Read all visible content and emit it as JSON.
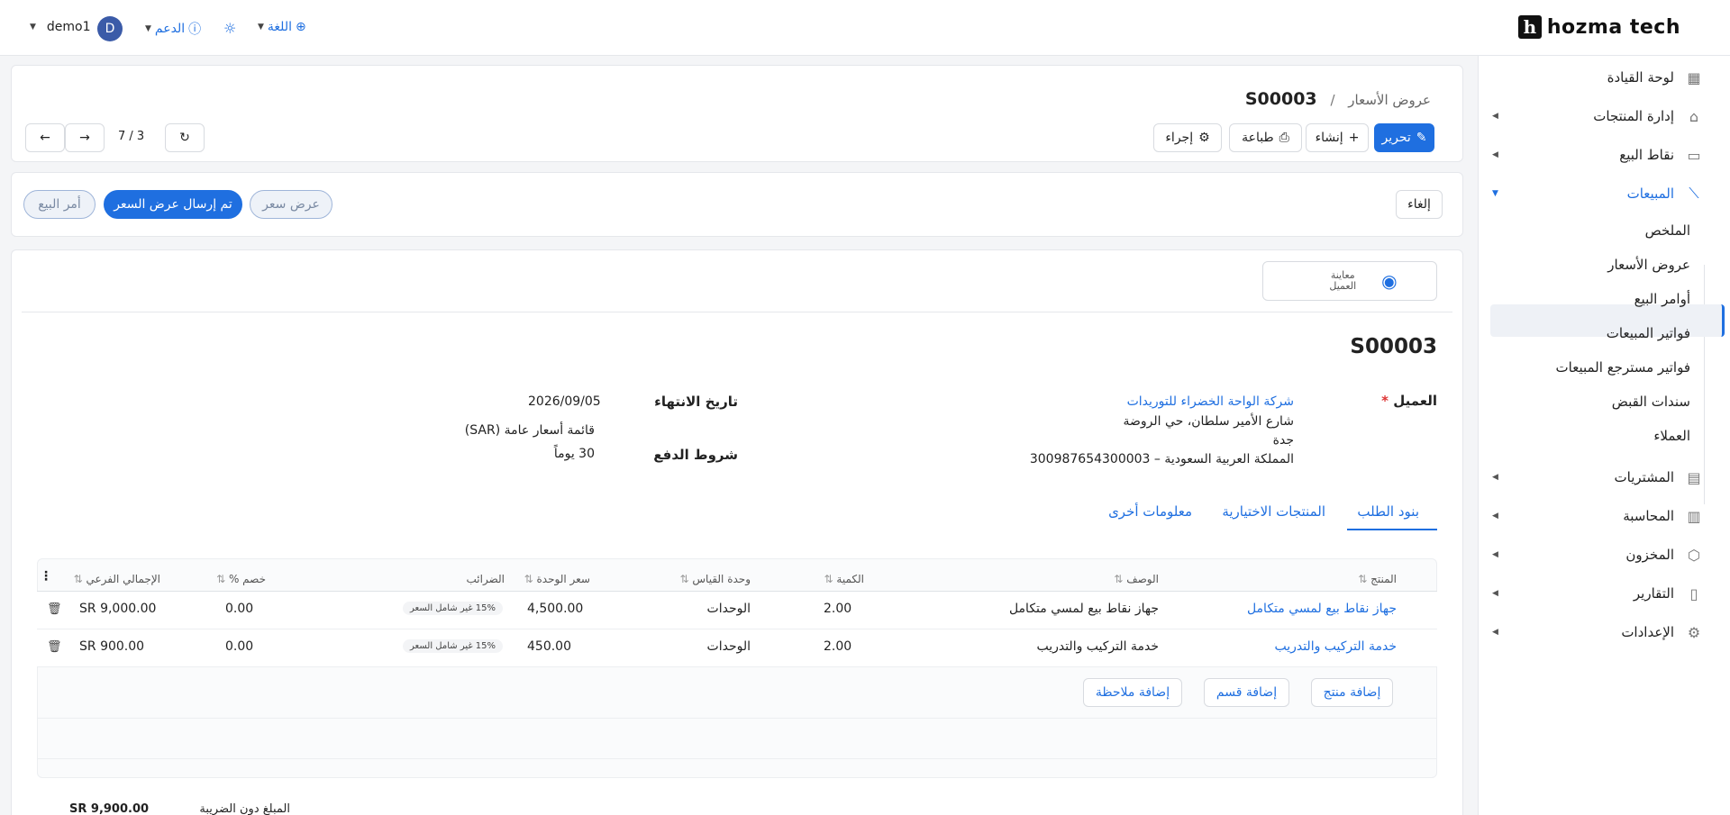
{
  "brand": {
    "logo_letter": "h",
    "name": "hozma tech"
  },
  "topbar": {
    "language": "اللغة",
    "support": "الدعم",
    "username": "demo1",
    "avatar_letter": "D"
  },
  "sidebar": {
    "items": [
      {
        "label": "لوحة القيادة",
        "icon": "grid-icon"
      },
      {
        "label": "إدارة المنتجات",
        "icon": "tag-icon"
      },
      {
        "label": "نقاط البيع",
        "icon": "store-icon"
      },
      {
        "label": "المبيعات",
        "icon": "chart-icon"
      },
      {
        "label": "المشتريات",
        "icon": "wallet-icon"
      },
      {
        "label": "المحاسبة",
        "icon": "ledger-icon"
      },
      {
        "label": "المخزون",
        "icon": "box-icon"
      },
      {
        "label": "التقارير",
        "icon": "report-icon"
      },
      {
        "label": "الإعدادات",
        "icon": "gear-icon"
      }
    ],
    "sales_sub": [
      "الملخص",
      "عروض الأسعار",
      "أوامر البيع",
      "فواتير المبيعات",
      "فواتير مسترجع المبيعات",
      "سندات القبض",
      "العملاء"
    ]
  },
  "header": {
    "breadcrumb_parent": "عروض الأسعار",
    "breadcrumb_sep": "/",
    "record_id": "S00003",
    "edit_label": "تحرير",
    "create_label": "إنشاء",
    "print_label": "طباعة",
    "action_label": "إجراء",
    "pager": "7 / 3"
  },
  "status": {
    "cancel_label": "إلغاء",
    "stages": [
      "عرض سعر",
      "تم إرسال عرض السعر",
      "أمر البيع"
    ]
  },
  "preview": {
    "label_line1": "معاينة",
    "label_line2": "العميل"
  },
  "form": {
    "title": "S00003",
    "customer_label": "العميل",
    "required_mark": "*",
    "customer_name": "شركة الواحة الخضراء للتوريدات",
    "address_line1": "شارع الأمير سلطان، حي الروضة",
    "address_line2": "جدة",
    "address_line3": "المملكة العربية السعودية – 300987654300003",
    "expiry_label": "تاريخ الانتهاء",
    "expiry_value": "2026/09/05",
    "pricelist_value": "قائمة أسعار عامة (SAR)",
    "payment_label": "شروط الدفع",
    "payment_value": "30 يوماً"
  },
  "tabs": [
    "بنود الطلب",
    "المنتجات الاختيارية",
    "معلومات أخرى"
  ],
  "table": {
    "headers": [
      "المنتج",
      "الوصف",
      "الكمية",
      "وحدة القياس",
      "سعر الوحدة",
      "الضرائب",
      "خصم %",
      "الإجمالي الفرعي"
    ],
    "rows": [
      {
        "product": "جهاز نقاط بيع لمسي متكامل",
        "description": "جهاز نقاط بيع لمسي متكامل",
        "qty": "2.00",
        "uom": "الوحدات",
        "price": "4,500.00",
        "tax": "15% غير شامل السعر",
        "discount": "0.00",
        "subtotal": "SR 9,000.00"
      },
      {
        "product": "خدمة التركيب والتدريب",
        "description": "خدمة التركيب والتدريب",
        "qty": "2.00",
        "uom": "الوحدات",
        "price": "450.00",
        "tax": "15% غير شامل السعر",
        "discount": "0.00",
        "subtotal": "SR 900.00"
      }
    ],
    "add_product": "إضافة منتج",
    "add_section": "إضافة قسم",
    "add_note": "إضافة ملاحظة"
  },
  "totals": {
    "untaxed_label": "المبلغ دون الضريبة",
    "untaxed_value": "SR 9,900.00"
  }
}
